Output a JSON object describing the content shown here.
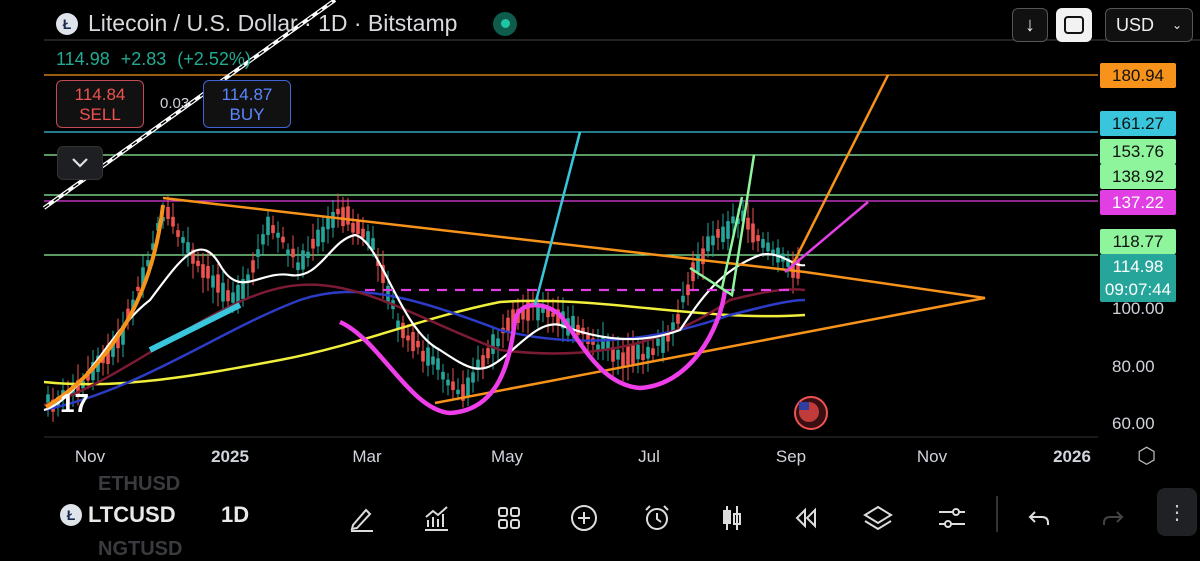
{
  "header": {
    "logo_letter": "Ł",
    "title": "Litecoin / U.S. Dollar · 1D · Bitstamp",
    "last": "114.98",
    "change": "+2.83",
    "change_pct": "(+2.52%)"
  },
  "trade": {
    "sell_price": "114.84",
    "sell_label": "SELL",
    "spread": "0.03",
    "buy_price": "114.87",
    "buy_label": "BUY"
  },
  "toolbar_top": {
    "download_icon": "arrow-down-icon",
    "fullscreen_icon": "fullscreen-icon",
    "currency": "USD"
  },
  "price_labels": [
    {
      "text": "180.94",
      "bg": "#f7931a",
      "fg": "#111"
    },
    {
      "text": "161.27",
      "bg": "#39c6dc",
      "fg": "#111"
    },
    {
      "text": "153.76",
      "bg": "#8ef59c",
      "fg": "#111"
    },
    {
      "text": "138.92",
      "bg": "#8ef59c",
      "fg": "#111"
    },
    {
      "text": "137.22",
      "bg": "#e13ee3",
      "fg": "#fff"
    },
    {
      "text": "118.77",
      "bg": "#8ef59c",
      "fg": "#111"
    },
    {
      "text": "114.98",
      "bg": "#26a69a",
      "fg": "#fff"
    },
    {
      "text": "09:07:44",
      "bg": "#26a69a",
      "fg": "#fff"
    }
  ],
  "y_axis": [
    "100.00",
    "80.00",
    "60.00"
  ],
  "x_axis": [
    "Nov",
    "2025",
    "Mar",
    "May",
    "Jul",
    "Sep",
    "Nov",
    "2026"
  ],
  "bottom": {
    "symbol": "LTCUSD",
    "ghost_above": "ETHUSD",
    "ghost_below": "NGTUSD",
    "timeframe": "1D",
    "tools": [
      "pen-icon",
      "indicators-icon",
      "grid-icon",
      "plus-icon",
      "alarm-icon",
      "candles-icon",
      "replay-icon",
      "layers-icon",
      "settings-icon",
      "undo-icon",
      "redo-icon",
      "more-icon"
    ]
  },
  "colors": {
    "up": "#26a69a",
    "down": "#ef5350",
    "accent": "#f7931a"
  }
}
